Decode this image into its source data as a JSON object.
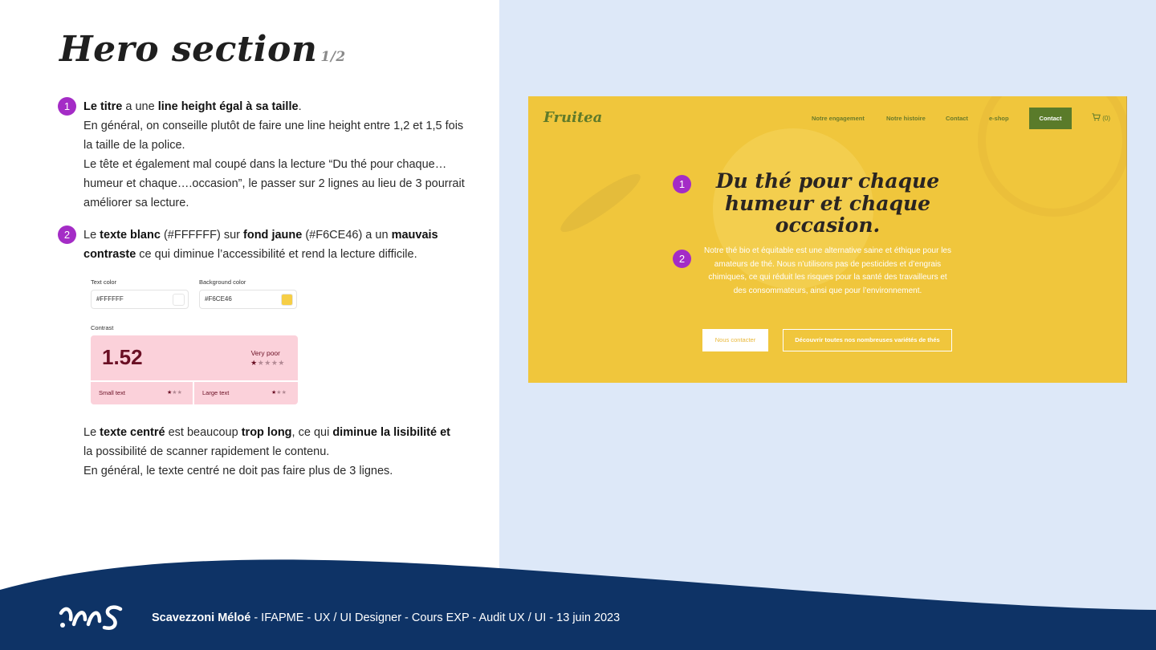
{
  "colors": {
    "accent_badge": "#A42CC6",
    "right_panel_bg": "#DDE8F8",
    "footer_bg": "#0E3366",
    "mock_bg": "#F0C63C",
    "mock_green": "#5A7B2A",
    "contrast_bad_bg": "#FBD1DA"
  },
  "slide": {
    "title": "Hero section",
    "subtitle": "1/2"
  },
  "notes": [
    {
      "badge": "1",
      "lines": [
        [
          [
            "b",
            "Le titre"
          ],
          [
            "t",
            " a une "
          ],
          [
            "b",
            "line height égal à sa taille"
          ],
          [
            "t",
            "."
          ]
        ],
        [
          [
            "t",
            "En général, on conseille plutôt de faire une line height entre 1,2 et 1,5 fois"
          ]
        ],
        [
          [
            "t",
            "la taille de la police."
          ]
        ],
        [
          [
            "t",
            "Le tête et également mal coupé dans la lecture “Du thé pour chaque…"
          ]
        ],
        [
          [
            "t",
            "humeur et chaque….occasion”, le passer sur 2 lignes au lieu de 3 pourrait"
          ]
        ],
        [
          [
            "t",
            "améliorer sa lecture."
          ]
        ]
      ]
    },
    {
      "badge": "2",
      "lines": [
        [
          [
            "t",
            "Le "
          ],
          [
            "b",
            "texte blanc"
          ],
          [
            "t",
            " (#FFFFFF) sur "
          ],
          [
            "b",
            "fond jaune"
          ],
          [
            "t",
            " (#F6CE46) a un "
          ],
          [
            "b",
            "mauvais"
          ]
        ],
        [
          [
            "b",
            "contraste"
          ],
          [
            "t",
            " ce qui diminue l’accessibilité et rend la lecture difficile."
          ]
        ]
      ]
    },
    {
      "badge": "",
      "lines": [
        [
          [
            "t",
            "Le "
          ],
          [
            "b",
            "texte centré"
          ],
          [
            "t",
            " est beaucoup "
          ],
          [
            "b",
            "trop long"
          ],
          [
            "t",
            ", ce qui "
          ],
          [
            "b",
            "diminue la lisibilité et"
          ]
        ],
        [
          [
            "t",
            "la possibilité de scanner  rapidement le contenu."
          ]
        ],
        [
          [
            "t",
            "En général, le texte centré ne doit pas faire plus de 3 lignes."
          ]
        ]
      ]
    }
  ],
  "contrast_checker": {
    "text_color_label": "Text color",
    "text_color_value": "#FFFFFF",
    "text_color_swatch": "#FFFFFF",
    "bg_color_label": "Background color",
    "bg_color_value": "#F6CE46",
    "bg_color_swatch": "#F6CE46",
    "contrast_label": "Contrast",
    "ratio": "1.52",
    "verdict": "Very poor",
    "rating_stars": 1,
    "rating_max": 5,
    "small_text_label": "Small text",
    "small_text_stars": 1,
    "large_text_label": "Large text",
    "large_text_stars": 1,
    "mini_max": 3
  },
  "mockup": {
    "logo": "Fruitea",
    "nav": [
      "Notre engagement",
      "Notre histoire",
      "Contact",
      "e-shop"
    ],
    "contact_button": "Contact",
    "cart": "(0)",
    "title_lines": [
      "Du thé pour chaque",
      "humeur et chaque",
      "occasion."
    ],
    "body_text": "Notre thé bio et équitable est une alternative saine et éthique pour les amateurs de thé. Nous n’utilisons pas de pesticides et d’engrais chimiques, ce qui réduit les risques pour la santé des travailleurs et des consommateurs, ainsi que pour l’environnement.",
    "cta_primary": "Nous contacter",
    "cta_secondary": "Découvrir toutes nos nombreuses variétés de thés",
    "badges": [
      "1",
      "2"
    ]
  },
  "footer": {
    "author": "Scavezzoni Méloé",
    "details": " - IFAPME - UX / UI Designer - Cours EXP - Audit UX / UI - 13 juin 2023",
    "logo_icon": "ms-monogram-icon"
  }
}
